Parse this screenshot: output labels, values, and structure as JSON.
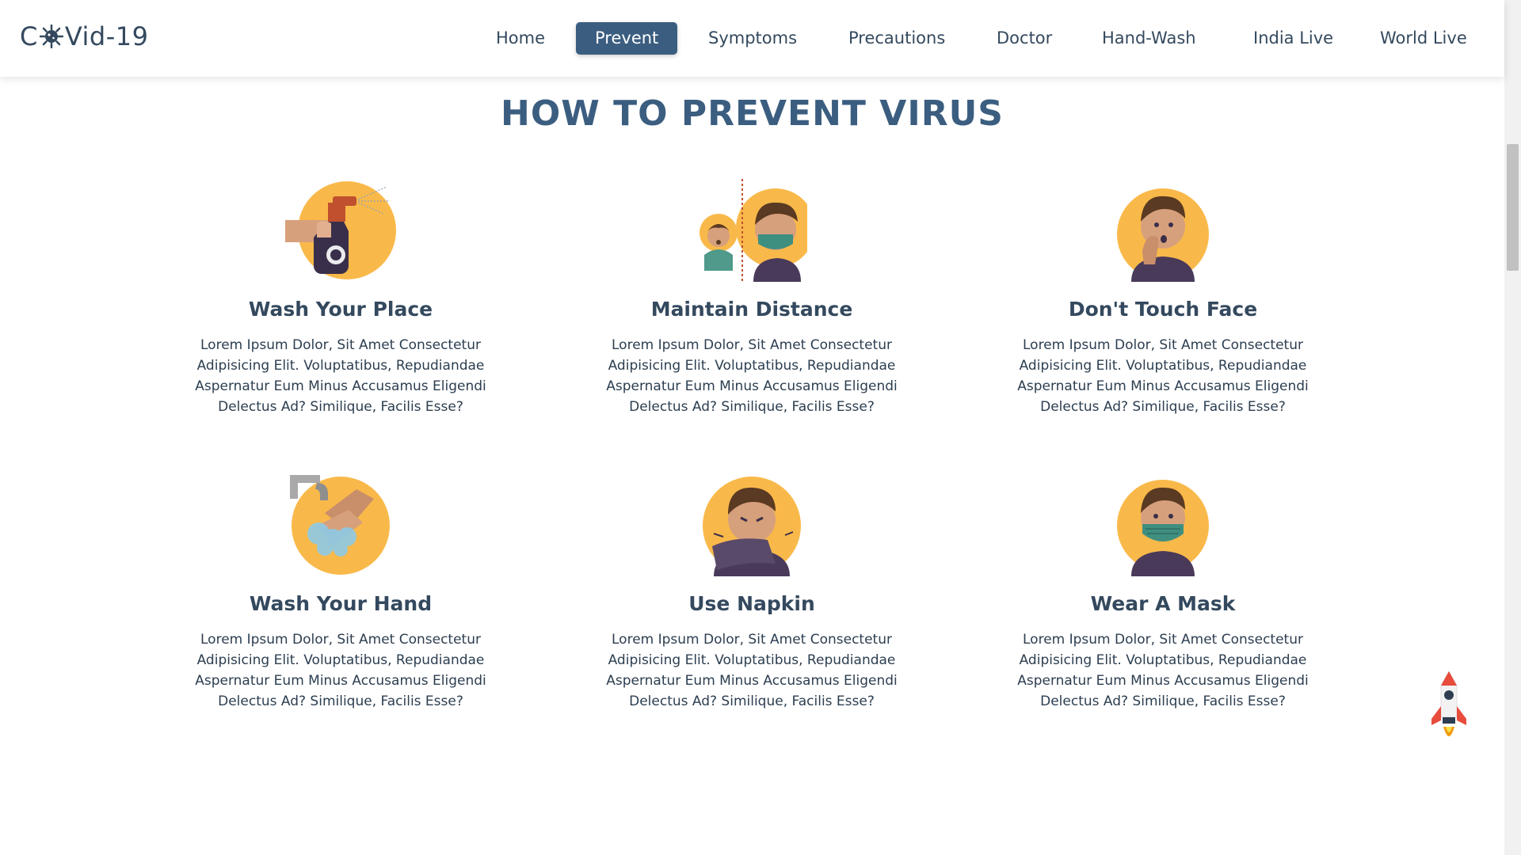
{
  "logo": {
    "prefix": "C",
    "suffix": "Vid-19",
    "icon": "virus-icon"
  },
  "nav": {
    "items": [
      {
        "label": "Home",
        "active": false
      },
      {
        "label": "Prevent",
        "active": true
      },
      {
        "label": "Symptoms",
        "active": false
      },
      {
        "label": "Precautions",
        "active": false
      },
      {
        "label": "Doctor",
        "active": false
      },
      {
        "label": "Hand-Wash",
        "active": false
      },
      {
        "label": "India Live",
        "active": false
      },
      {
        "label": "World Live",
        "active": false
      }
    ]
  },
  "main": {
    "title": "HOW TO PREVENT VIRUS",
    "cards": [
      {
        "title": "Wash Your Place",
        "icon": "spray-bottle-icon",
        "desc": "Lorem Ipsum Dolor, Sit Amet Consectetur Adipisicing Elit. Voluptatibus, Repudiandae Aspernatur Eum Minus Accusamus Eligendi Delectus Ad? Similique, Facilis Esse?"
      },
      {
        "title": "Maintain Distance",
        "icon": "distance-icon",
        "desc": "Lorem Ipsum Dolor, Sit Amet Consectetur Adipisicing Elit. Voluptatibus, Repudiandae Aspernatur Eum Minus Accusamus Eligendi Delectus Ad? Similique, Facilis Esse?"
      },
      {
        "title": "Don't Touch Face",
        "icon": "touch-face-icon",
        "desc": "Lorem Ipsum Dolor, Sit Amet Consectetur Adipisicing Elit. Voluptatibus, Repudiandae Aspernatur Eum Minus Accusamus Eligendi Delectus Ad? Similique, Facilis Esse?"
      },
      {
        "title": "Wash Your Hand",
        "icon": "hand-wash-icon",
        "desc": "Lorem Ipsum Dolor, Sit Amet Consectetur Adipisicing Elit. Voluptatibus, Repudiandae Aspernatur Eum Minus Accusamus Eligendi Delectus Ad? Similique, Facilis Esse?"
      },
      {
        "title": "Use Napkin",
        "icon": "napkin-icon",
        "desc": "Lorem Ipsum Dolor, Sit Amet Consectetur Adipisicing Elit. Voluptatibus, Repudiandae Aspernatur Eum Minus Accusamus Eligendi Delectus Ad? Similique, Facilis Esse?"
      },
      {
        "title": "Wear A Mask",
        "icon": "mask-icon",
        "desc": "Lorem Ipsum Dolor, Sit Amet Consectetur Adipisicing Elit. Voluptatibus, Repudiandae Aspernatur Eum Minus Accusamus Eligendi Delectus Ad? Similique, Facilis Esse?"
      }
    ]
  },
  "scroll_top": {
    "icon": "rocket-icon"
  },
  "colors": {
    "primary": "#3b5e80",
    "text": "#34495e",
    "accent": "#f9b94a",
    "skin": "#d7a07c",
    "hair": "#5a3a22",
    "shirt": "#4a3a5a",
    "mask": "#3f8f80"
  }
}
